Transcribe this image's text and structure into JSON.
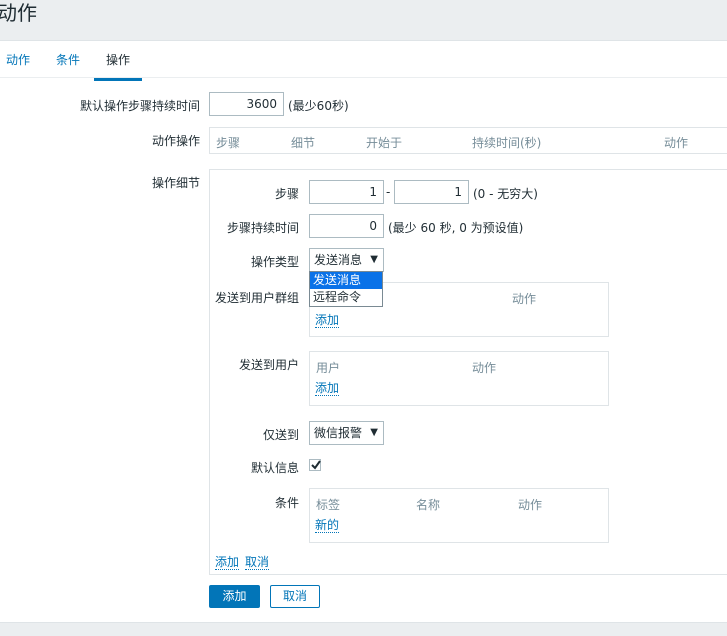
{
  "page": {
    "title": "动作"
  },
  "tabs": [
    {
      "label": "动作"
    },
    {
      "label": "条件"
    },
    {
      "label": "操作"
    }
  ],
  "form": {
    "default_duration_label": "默认操作步骤持续时间",
    "default_duration_value": "3600",
    "default_duration_hint": "(最少60秒)",
    "operations_label": "动作操作",
    "operations_columns": [
      "步骤",
      "细节",
      "开始于",
      "持续时间(秒)",
      "动作"
    ],
    "details_label": "操作细节"
  },
  "details": {
    "steps_label": "步骤",
    "step_from": "1",
    "step_sep": "-",
    "step_to": "1",
    "steps_hint": "(0 - 无穷大)",
    "step_duration_label": "步骤持续时间",
    "step_duration_value": "0",
    "step_duration_hint": "(最少 60 秒, 0 为预设值)",
    "op_type_label": "操作类型",
    "op_type_value": "发送消息",
    "op_type_options": [
      "发送消息",
      "远程命令"
    ],
    "send_groups_label": "发送到用户群组",
    "send_groups_action_col": "动作",
    "send_groups_add": "添加",
    "send_users_label": "发送到用户",
    "send_users_user_col": "用户",
    "send_users_action_col": "动作",
    "send_users_add": "添加",
    "send_only_label": "仅送到",
    "send_only_value": "微信报警",
    "default_msg_label": "默认信息",
    "default_msg_checked": true,
    "conditions_label": "条件",
    "conditions_columns": [
      "标签",
      "名称",
      "动作"
    ],
    "conditions_new": "新的",
    "add_link": "添加",
    "cancel_link": "取消"
  },
  "buttons": {
    "add": "添加",
    "cancel": "取消"
  }
}
